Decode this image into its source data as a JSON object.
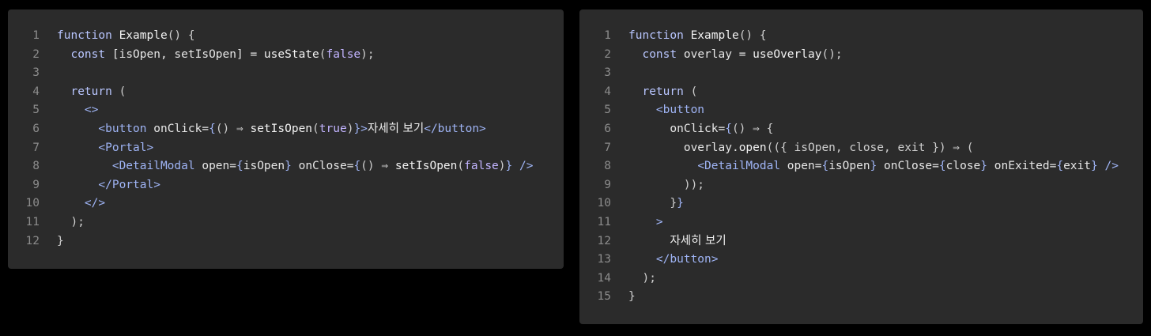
{
  "colors": {
    "background": "#000000",
    "panel": "#2b2b2b",
    "line_number": "#8c8c8c",
    "keyword": "#b9c6ff",
    "tag": "#9fb4f5",
    "literal": "#c2b4ff",
    "text": "#e6e6e6"
  },
  "panels": [
    {
      "lines": [
        {
          "n": "1",
          "tokens": [
            [
              "kw",
              "function"
            ],
            [
              "pl",
              " "
            ],
            [
              "fn",
              "Example"
            ],
            [
              "pu",
              "() {"
            ]
          ]
        },
        {
          "n": "2",
          "tokens": [
            [
              "pl",
              "  "
            ],
            [
              "kw",
              "const"
            ],
            [
              "pl",
              " [isOpen, setIsOpen] = "
            ],
            [
              "fn",
              "useState"
            ],
            [
              "pu",
              "("
            ],
            [
              "lt",
              "false"
            ],
            [
              "pu",
              ");"
            ]
          ]
        },
        {
          "n": "3",
          "tokens": []
        },
        {
          "n": "4",
          "tokens": [
            [
              "pl",
              "  "
            ],
            [
              "kw",
              "return"
            ],
            [
              "pu",
              " ("
            ]
          ]
        },
        {
          "n": "5",
          "tokens": [
            [
              "pl",
              "    "
            ],
            [
              "tg",
              "<>"
            ]
          ]
        },
        {
          "n": "6",
          "tokens": [
            [
              "pl",
              "      "
            ],
            [
              "tg",
              "<button"
            ],
            [
              "pl",
              " onClick="
            ],
            [
              "br",
              "{"
            ],
            [
              "pu",
              "() ⇒ "
            ],
            [
              "fn",
              "setIsOpen"
            ],
            [
              "pu",
              "("
            ],
            [
              "lt",
              "true"
            ],
            [
              "pu",
              ")"
            ],
            [
              "br",
              "}"
            ],
            [
              "tg",
              ">"
            ],
            [
              "kr",
              "자세히 보기"
            ],
            [
              "tg",
              "</button>"
            ]
          ]
        },
        {
          "n": "7",
          "tokens": [
            [
              "pl",
              "      "
            ],
            [
              "tg",
              "<Portal>"
            ]
          ]
        },
        {
          "n": "8",
          "tokens": [
            [
              "pl",
              "        "
            ],
            [
              "tg",
              "<DetailModal"
            ],
            [
              "pl",
              " open="
            ],
            [
              "br",
              "{"
            ],
            [
              "pl",
              "isOpen"
            ],
            [
              "br",
              "}"
            ],
            [
              "pl",
              " onClose="
            ],
            [
              "br",
              "{"
            ],
            [
              "pu",
              "() ⇒ "
            ],
            [
              "fn",
              "setIsOpen"
            ],
            [
              "pu",
              "("
            ],
            [
              "lt",
              "false"
            ],
            [
              "pu",
              ")"
            ],
            [
              "br",
              "}"
            ],
            [
              "pl",
              " "
            ],
            [
              "tg",
              "/>"
            ]
          ]
        },
        {
          "n": "9",
          "tokens": [
            [
              "pl",
              "      "
            ],
            [
              "tg",
              "</Portal>"
            ]
          ]
        },
        {
          "n": "10",
          "tokens": [
            [
              "pl",
              "    "
            ],
            [
              "tg",
              "</>"
            ]
          ]
        },
        {
          "n": "11",
          "tokens": [
            [
              "pl",
              "  "
            ],
            [
              "pu",
              ");"
            ]
          ]
        },
        {
          "n": "12",
          "tokens": [
            [
              "pu",
              "}"
            ]
          ]
        }
      ]
    },
    {
      "lines": [
        {
          "n": "1",
          "tokens": [
            [
              "kw",
              "function"
            ],
            [
              "pl",
              " "
            ],
            [
              "fn",
              "Example"
            ],
            [
              "pu",
              "() {"
            ]
          ]
        },
        {
          "n": "2",
          "tokens": [
            [
              "pl",
              "  "
            ],
            [
              "kw",
              "const"
            ],
            [
              "pl",
              " overlay = "
            ],
            [
              "fn",
              "useOverlay"
            ],
            [
              "pu",
              "();"
            ]
          ]
        },
        {
          "n": "3",
          "tokens": []
        },
        {
          "n": "4",
          "tokens": [
            [
              "pl",
              "  "
            ],
            [
              "kw",
              "return"
            ],
            [
              "pu",
              " ("
            ]
          ]
        },
        {
          "n": "5",
          "tokens": [
            [
              "pl",
              "    "
            ],
            [
              "tg",
              "<button"
            ]
          ]
        },
        {
          "n": "6",
          "tokens": [
            [
              "pl",
              "      onClick="
            ],
            [
              "br",
              "{"
            ],
            [
              "pu",
              "() ⇒ {"
            ]
          ]
        },
        {
          "n": "7",
          "tokens": [
            [
              "pl",
              "        overlay."
            ],
            [
              "fn",
              "open"
            ],
            [
              "pu",
              "(({ isOpen, close, exit }) ⇒ ("
            ]
          ]
        },
        {
          "n": "8",
          "tokens": [
            [
              "pl",
              "          "
            ],
            [
              "tg",
              "<DetailModal"
            ],
            [
              "pl",
              " open="
            ],
            [
              "br",
              "{"
            ],
            [
              "pl",
              "isOpen"
            ],
            [
              "br",
              "}"
            ],
            [
              "pl",
              " onClose="
            ],
            [
              "br",
              "{"
            ],
            [
              "pl",
              "close"
            ],
            [
              "br",
              "}"
            ],
            [
              "pl",
              " onExited="
            ],
            [
              "br",
              "{"
            ],
            [
              "pl",
              "exit"
            ],
            [
              "br",
              "}"
            ],
            [
              "pl",
              " "
            ],
            [
              "tg",
              "/>"
            ]
          ]
        },
        {
          "n": "9",
          "tokens": [
            [
              "pl",
              "        "
            ],
            [
              "pu",
              "));"
            ]
          ]
        },
        {
          "n": "10",
          "tokens": [
            [
              "pl",
              "      "
            ],
            [
              "pu",
              "}"
            ],
            [
              "br",
              "}"
            ]
          ]
        },
        {
          "n": "11",
          "tokens": [
            [
              "pl",
              "    "
            ],
            [
              "tg",
              ">"
            ]
          ]
        },
        {
          "n": "12",
          "tokens": [
            [
              "pl",
              "      "
            ],
            [
              "kr",
              "자세히 보기"
            ]
          ]
        },
        {
          "n": "13",
          "tokens": [
            [
              "pl",
              "    "
            ],
            [
              "tg",
              "</button>"
            ]
          ]
        },
        {
          "n": "14",
          "tokens": [
            [
              "pl",
              "  "
            ],
            [
              "pu",
              ");"
            ]
          ]
        },
        {
          "n": "15",
          "tokens": [
            [
              "pu",
              "}"
            ]
          ]
        }
      ]
    }
  ]
}
